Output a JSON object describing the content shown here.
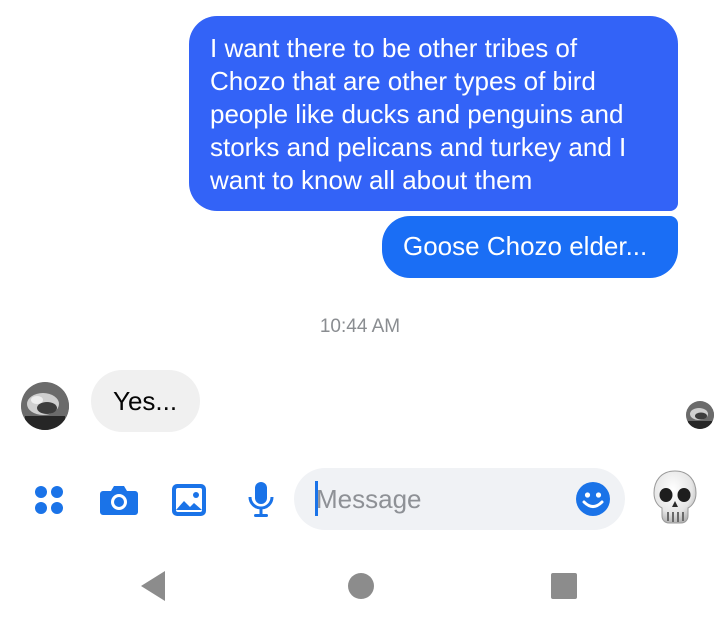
{
  "conversation": {
    "messages_out": [
      {
        "text": "I want there to be other tribes of Chozo that are other types of bird people like ducks and penguins and storks and pelicans and turkey and I want to know all about them"
      },
      {
        "text": "Goose Chozo elder..."
      }
    ],
    "timestamp": "10:44 AM",
    "messages_in": [
      {
        "text": "Yes..."
      }
    ]
  },
  "composer": {
    "placeholder": "Message",
    "value": "",
    "icons": [
      "apps-icon",
      "camera-icon",
      "gallery-icon",
      "microphone-icon",
      "emoji-icon",
      "skull-emoji"
    ]
  },
  "nav_bar": {
    "buttons": [
      "back",
      "home",
      "recents"
    ]
  },
  "colors": {
    "outgoing_bubble": "#3363f7",
    "outgoing_bubble_2": "#1a6ef5",
    "incoming_bubble": "#f0f0f0",
    "accent": "#1a73e8",
    "timestamp": "#8a8d91",
    "nav_icons": "#8c8c8c"
  }
}
